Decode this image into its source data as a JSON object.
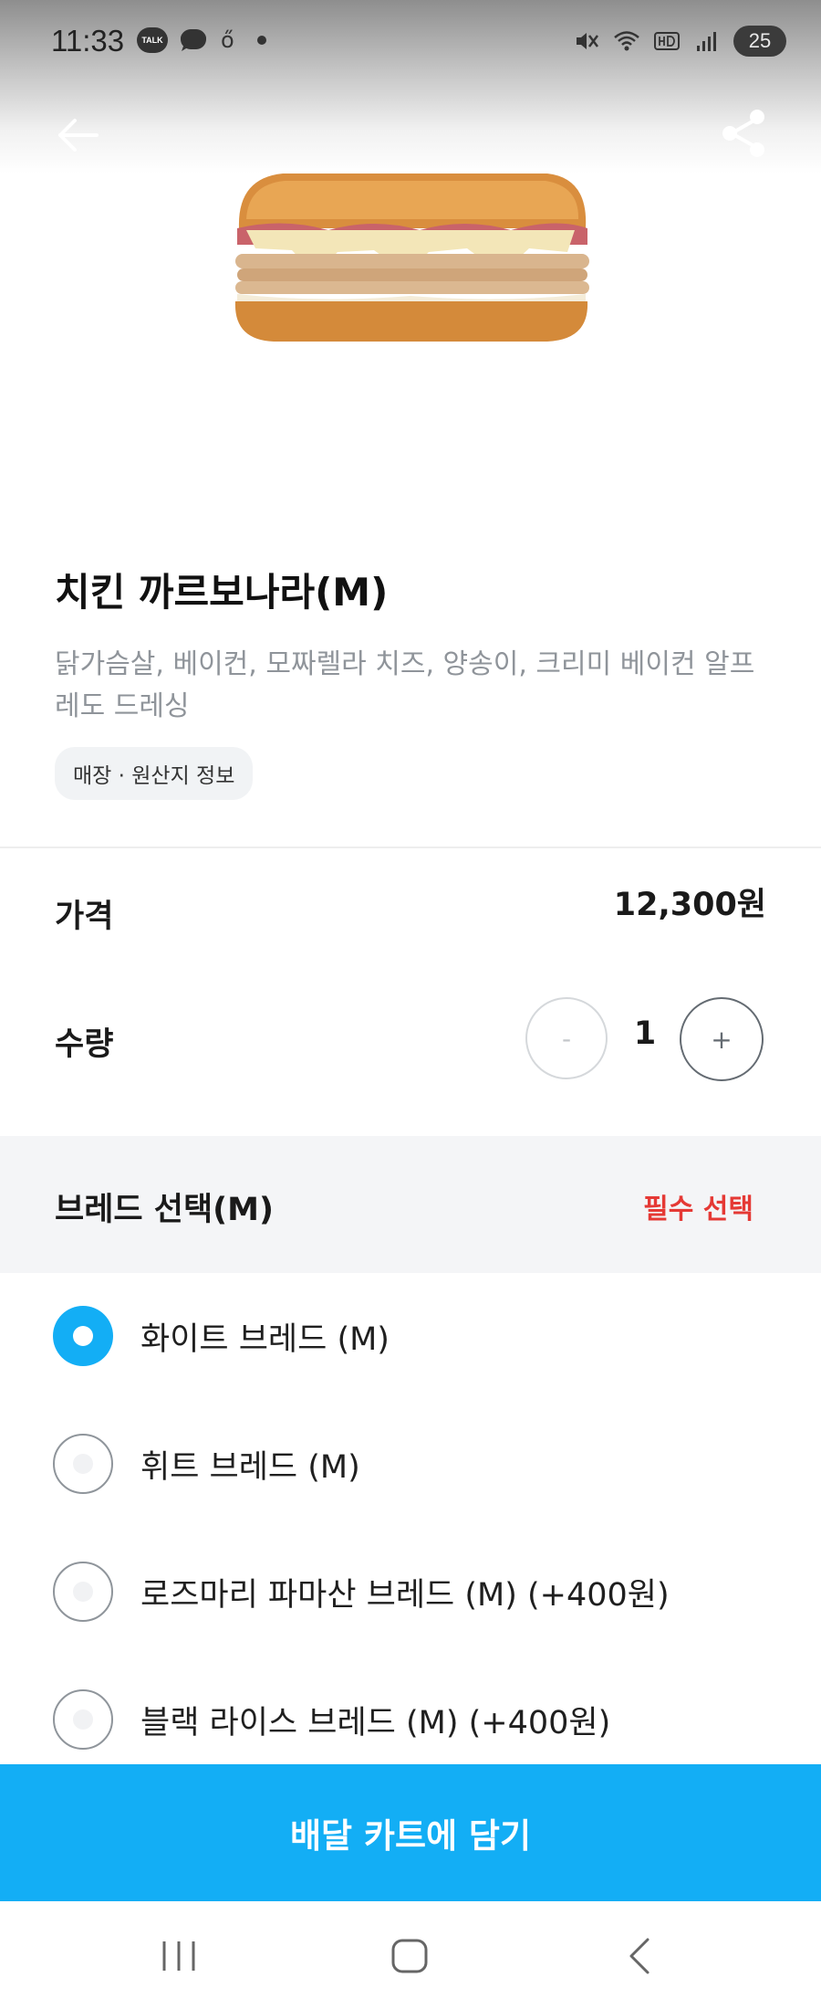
{
  "status_bar": {
    "time": "11:33",
    "talk_icon_label": "TALK",
    "notif_glyph": "ő",
    "battery_level": "25",
    "icons": [
      "talk-icon",
      "chat-bubble-icon",
      "notification-icon",
      "dot-icon",
      "mute-icon",
      "wifi-icon",
      "hd-icon",
      "signal-icon",
      "battery-icon"
    ]
  },
  "header": {
    "back_icon": "arrow-left-icon",
    "share_icon": "share-icon"
  },
  "product": {
    "image_alt": "sandwich-image",
    "name": "치킨 까르보나라(M)",
    "description": "닭가슴살, 베이컨, 모짜렐라 치즈, 양송이, 크리미 베이컨 알프레도 드레싱",
    "info_chip": "매장 · 원산지 정보"
  },
  "price": {
    "label": "가격",
    "value": "12,300원"
  },
  "quantity": {
    "label": "수량",
    "value": "1",
    "minus": "-",
    "plus": "+"
  },
  "bread_section": {
    "title": "브레드 선택(M)",
    "required_label": "필수 선택",
    "options": [
      {
        "label": "화이트 브레드 (M)",
        "selected": true
      },
      {
        "label": "휘트 브레드 (M)",
        "selected": false
      },
      {
        "label": "로즈마리 파마산 브레드 (M) (+400원)",
        "selected": false
      },
      {
        "label": "블랙 라이스 브레드 (M) (+400원)",
        "selected": false
      }
    ]
  },
  "cta": {
    "label": "배달 카트에 담기"
  },
  "colors": {
    "accent": "#13aef5",
    "required": "#e53935",
    "muted_text": "#8f949a",
    "section_bg": "#f4f5f7"
  },
  "nav_bar": {
    "icons": [
      "recent-apps-icon",
      "home-icon",
      "back-icon"
    ]
  }
}
